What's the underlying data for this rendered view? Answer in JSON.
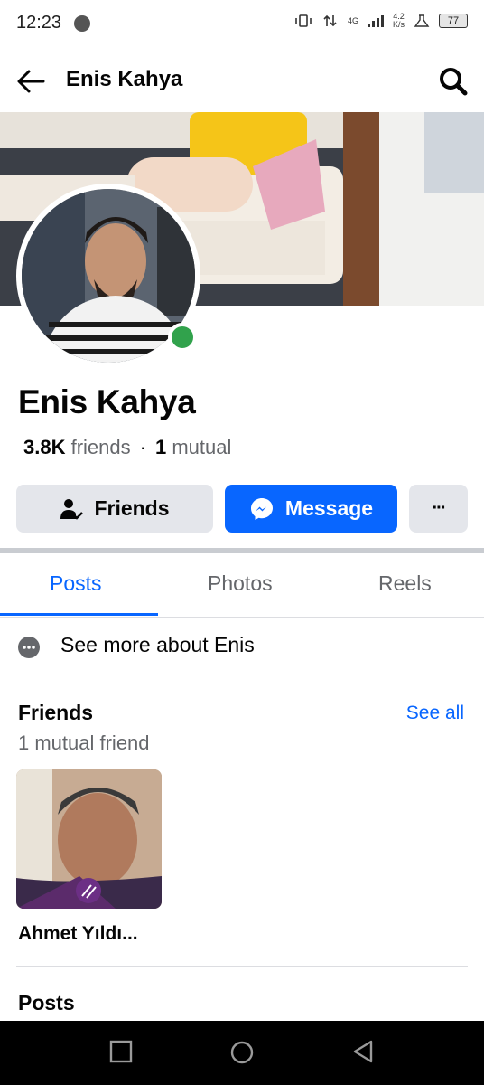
{
  "status_bar": {
    "time": "12:23",
    "network": "4G",
    "speed_value": "4.2",
    "speed_unit": "K/s",
    "battery": "77"
  },
  "header": {
    "title": "Enis Kahya"
  },
  "profile": {
    "name": "Enis Kahya",
    "friends_count": "3.8K",
    "friends_label": "friends",
    "mutual_count": "1",
    "mutual_label": "mutual",
    "online": true
  },
  "actions": {
    "friends_label": "Friends",
    "message_label": "Message",
    "more_label": "···"
  },
  "tabs": [
    {
      "label": "Posts",
      "active": true
    },
    {
      "label": "Photos",
      "active": false
    },
    {
      "label": "Reels",
      "active": false
    }
  ],
  "about": {
    "label": "See more about Enis"
  },
  "friends_section": {
    "title": "Friends",
    "see_all": "See all",
    "mutual_summary": "1 mutual friend",
    "items": [
      {
        "name": "Ahmet Yıldı..."
      }
    ]
  },
  "posts_section": {
    "title": "Posts"
  },
  "colors": {
    "accent": "#0866ff",
    "online": "#31a24c",
    "secondary_text": "#65676b"
  }
}
